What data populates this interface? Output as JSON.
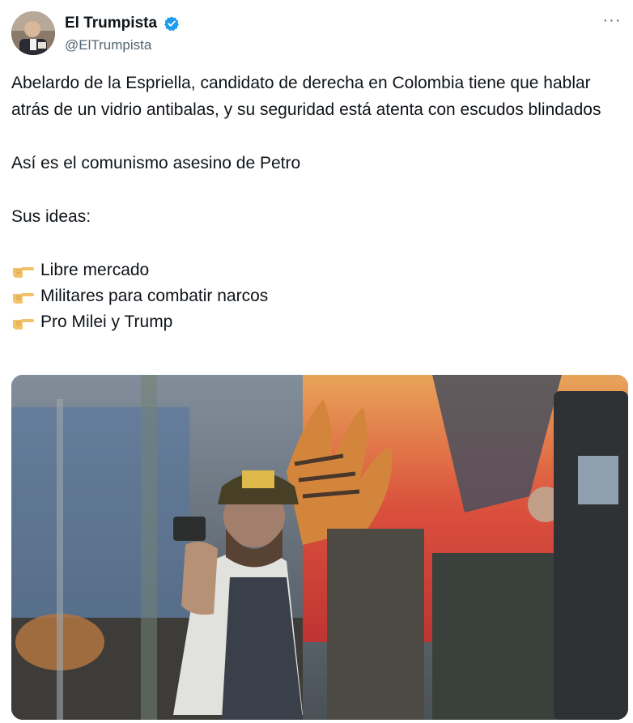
{
  "author": {
    "display_name": "El Trumpista",
    "handle": "@ElTrumpista",
    "verified_icon": "verified-badge-icon",
    "avatar_icon": "avatar"
  },
  "more_label": "···",
  "tweet": {
    "paragraph1": "Abelardo de la Espriella, candidato de derecha en Colombia tiene que hablar atrás de un vidrio antibalas, y su seguridad está atenta con escudos blindados",
    "paragraph2": "Así es el comunismo asesino de Petro",
    "paragraph3": "Sus ideas:",
    "bullets": [
      {
        "icon": "pointing-hand-icon",
        "text": "Libre mercado"
      },
      {
        "icon": "pointing-hand-icon",
        "text": "Militares para combatir narcos"
      },
      {
        "icon": "pointing-hand-icon",
        "text": "Pro Milei y Trump"
      }
    ]
  },
  "colors": {
    "verified": "#1d9bf0",
    "secondary_text": "#536471",
    "primary_text": "#0f1419"
  }
}
